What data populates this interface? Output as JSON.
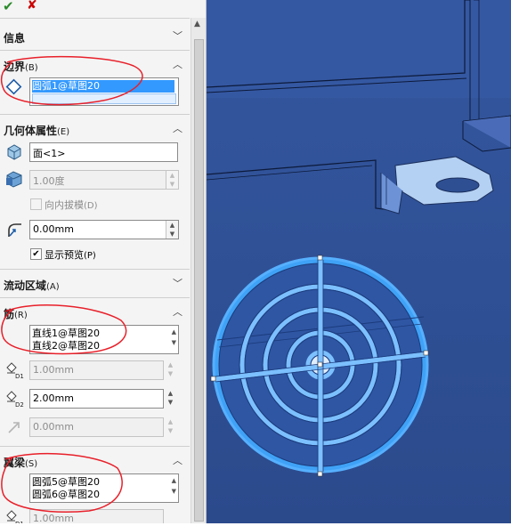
{
  "toolbar": {
    "ok_glyph": "✔",
    "cancel_glyph": "✘",
    "ok_color": "#2b8a2b",
    "cancel_color": "#cc0000"
  },
  "sections": {
    "info": {
      "title": "信息"
    },
    "boundary": {
      "title": "边界",
      "key": "(B)",
      "items": [
        "圆弧1@草图20"
      ]
    },
    "geometry": {
      "title": "几何体属性",
      "key": "(E)",
      "face": "面<1>",
      "draft_angle": "1.00度",
      "draft_inward_label": "向内拔模",
      "draft_inward_key": "(D)",
      "fillet_value": "0.00mm",
      "show_preview_label": "显示预览",
      "show_preview_key": "(P)",
      "show_preview_checked": true
    },
    "flow_area": {
      "title": "流动区域",
      "key": "(A)"
    },
    "ribs": {
      "title": "筋",
      "key": "(R)",
      "items": [
        "直线1@草图20",
        "直线2@草图20"
      ],
      "d1": "1.00mm",
      "d2": "2.00mm",
      "offset": "0.00mm"
    },
    "spars": {
      "title": "翼梁",
      "key": "(S)",
      "items": [
        "圆弧5@草图20",
        "圆弧6@草图20"
      ],
      "d1": "1.00mm"
    }
  },
  "colors": {
    "annotation": "#e8202a",
    "model_body": "#2f4f95",
    "model_highlight": "#48a0f0",
    "selection": "#3399ff",
    "panel_bg": "#f4f4f4"
  }
}
